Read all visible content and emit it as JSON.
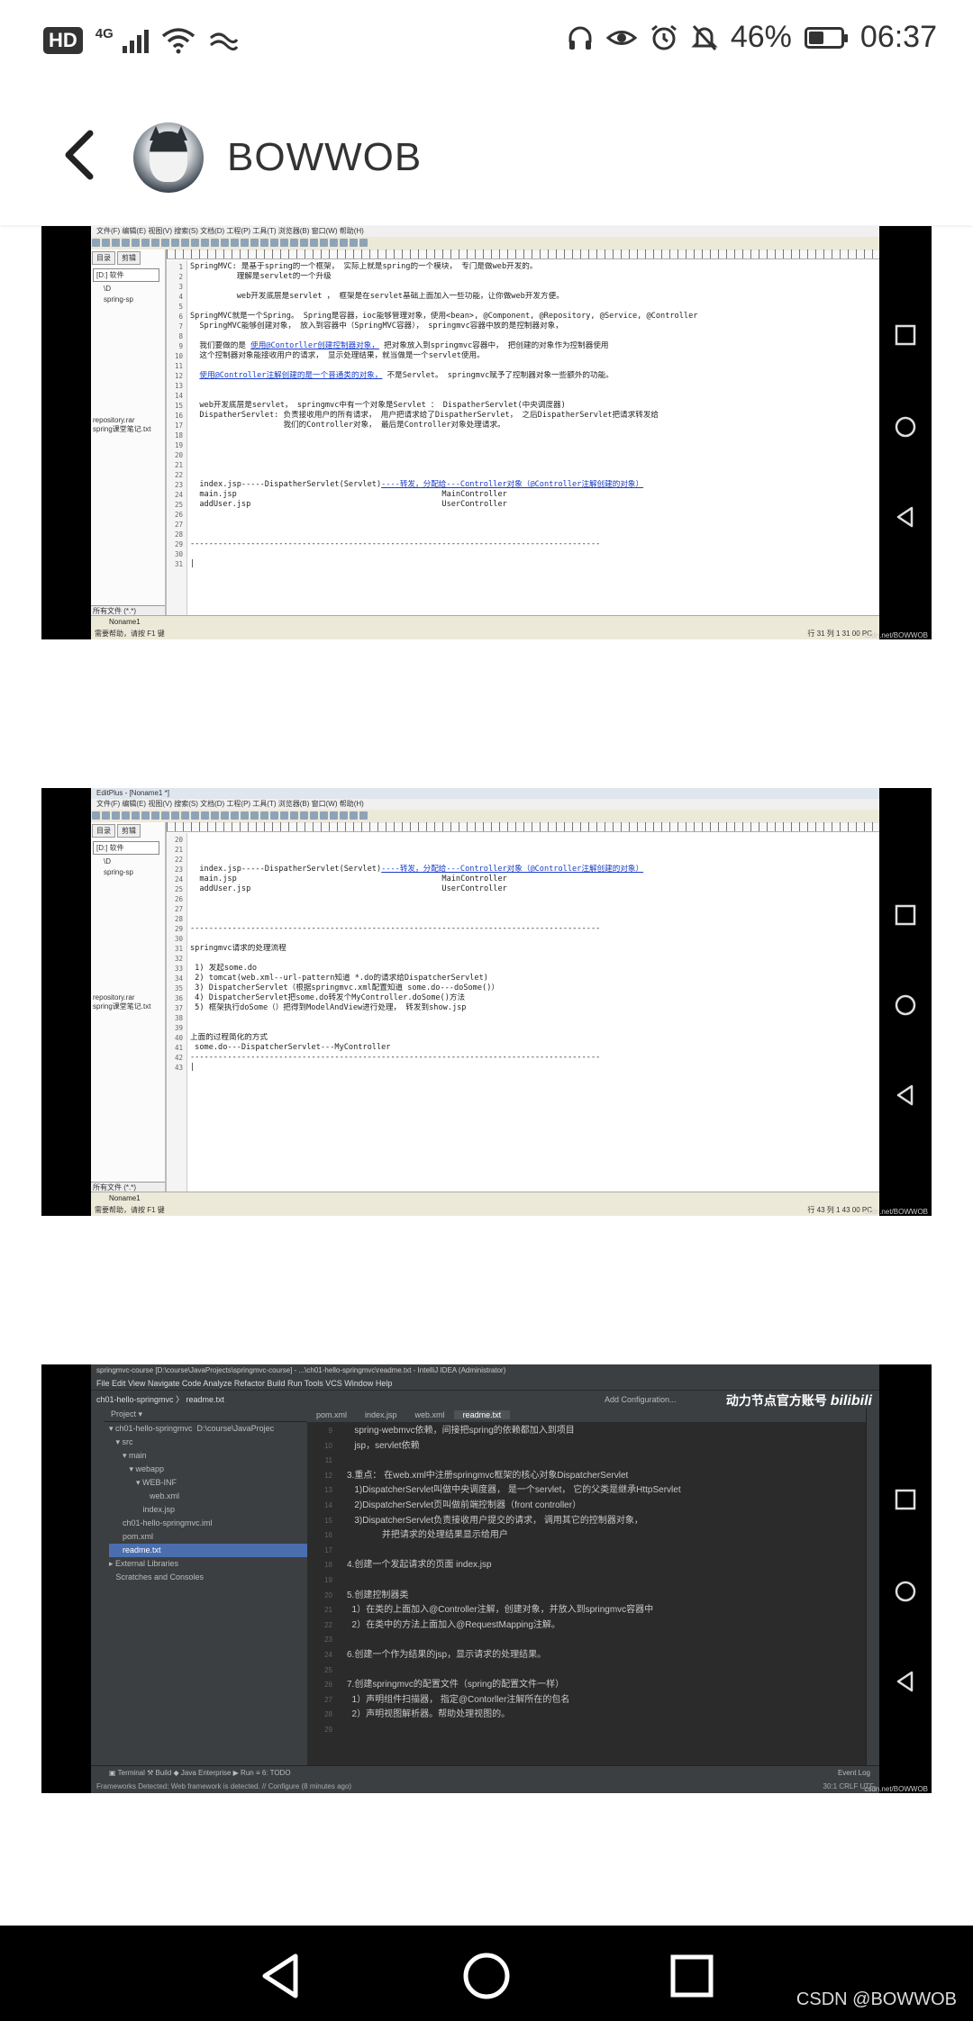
{
  "status_bar": {
    "hd": "HD",
    "network": "4G",
    "battery_percent": "46%",
    "battery_level": 0.46,
    "time": "06:37",
    "icons": [
      "signal-icon",
      "wifi-icon",
      "weather-icon",
      "headphones-icon",
      "eye-icon",
      "alarm-icon",
      "mute-icon",
      "battery-icon"
    ]
  },
  "header": {
    "username": "BOWWOB"
  },
  "frame1": {
    "menu": "文件(F)  编辑(E)  视图(V)  搜索(S)  文档(D)  工程(P)  工具(T)  浏览器(B)  窗口(W)  帮助(H)",
    "pane_tabs": [
      "目录",
      "剪辑"
    ],
    "drive": "[D:] 软件",
    "tree": [
      "\\D",
      "spring-sp"
    ],
    "files": [
      "repository.rar",
      "spring课堂笔记.txt"
    ],
    "filter": "所有文件 (*.*)",
    "doc_tab": "Noname1",
    "status_left": "需要帮助，请按 F1 键",
    "status_right": "行 31    列 1    31    00    PC",
    "lines": [
      {
        "n": "1",
        "t": "SpringMVC: 是基于spring的一个框架， 实际上就是spring的一个模块， 专门是做web开发的。"
      },
      {
        "n": "2",
        "t": "          理解是servlet的一个升级"
      },
      {
        "n": "3",
        "t": ""
      },
      {
        "n": "4",
        "t": "          web开发底层是servlet ， 框架是在servlet基础上面加入一些功能，让你做web开发方便。"
      },
      {
        "n": "5",
        "t": ""
      },
      {
        "n": "6",
        "t": "SpringMVC就是一个Spring。 Spring是容器，ioc能够管理对象，使用<bean>, @Component, @Repository, @Service, @Controller"
      },
      {
        "n": "7",
        "t": "  SpringMVC能够创建对象， 放入到容器中（SpringMVC容器）， springmvc容器中放的是控制器对象，"
      },
      {
        "n": "8",
        "t": ""
      },
      {
        "n": "9",
        "t": "  我们要做的是 使用@Contorller创建控制器对象， 把对象放入到springmvc容器中， 把创建的对象作为控制器使用"
      },
      {
        "n": "10",
        "t": "  这个控制器对象能接收用户的请求， 显示处理结果，就当做是一个servlet使用。"
      },
      {
        "n": "11",
        "t": ""
      },
      {
        "n": "12",
        "t": "  使用@Controller注解创建的是一个普通类的对象， 不是Servlet。 springmvc赋予了控制器对象一些额外的功能。"
      },
      {
        "n": "13",
        "t": ""
      },
      {
        "n": "14",
        "t": ""
      },
      {
        "n": "15",
        "t": "  web开发底层是servlet， springmvc中有一个对象是Servlet ： DispatherServlet(中央调度器)"
      },
      {
        "n": "16",
        "t": "  DispatherServlet: 负责接收用户的所有请求， 用户把请求给了DispatherServlet， 之后DispatherServlet把请求转发给"
      },
      {
        "n": "17",
        "t": "                    我们的Controller对象， 最后是Controller对象处理请求。"
      },
      {
        "n": "18",
        "t": ""
      },
      {
        "n": "19",
        "t": ""
      },
      {
        "n": "20",
        "t": ""
      },
      {
        "n": "21",
        "t": ""
      },
      {
        "n": "22",
        "t": ""
      },
      {
        "n": "23",
        "t": "  index.jsp-----DispatherServlet(Servlet)----转发，分配给---Controller对象（@Controller注解创建的对象）"
      },
      {
        "n": "24",
        "t": "  main.jsp                                            MainController"
      },
      {
        "n": "25",
        "t": "  addUser.jsp                                         UserController"
      },
      {
        "n": "26",
        "t": ""
      },
      {
        "n": "27",
        "t": ""
      },
      {
        "n": "28",
        "t": ""
      },
      {
        "n": "29",
        "t": "----------------------------------------------------------------------------------------"
      },
      {
        "n": "30",
        "t": ""
      },
      {
        "n": "31",
        "t": "|"
      }
    ]
  },
  "frame2": {
    "title": "EditPlus - [Noname1 *]",
    "menu": "文件(F)  编辑(E)  视图(V)  搜索(S)  文档(D)  工程(P)  工具(T)  浏览器(B)  窗口(W)  帮助(H)",
    "pane_tabs": [
      "目录",
      "剪辑"
    ],
    "drive": "[D:] 软件",
    "tree": [
      "\\D",
      "spring-sp"
    ],
    "files": [
      "repository.rar",
      "spring课堂笔记.txt"
    ],
    "filter": "所有文件 (*.*)",
    "doc_tab": "Noname1",
    "status_left": "需要帮助，请按 F1 键",
    "status_right": "行 43    列 1    43    00    PC",
    "lines": [
      {
        "n": "20",
        "t": ""
      },
      {
        "n": "21",
        "t": ""
      },
      {
        "n": "22",
        "t": ""
      },
      {
        "n": "23",
        "t": "  index.jsp-----DispatherServlet(Servlet)----转发，分配给---Controller对象（@Controller注解创建的对象）"
      },
      {
        "n": "24",
        "t": "  main.jsp                                            MainController"
      },
      {
        "n": "25",
        "t": "  addUser.jsp                                         UserController"
      },
      {
        "n": "26",
        "t": ""
      },
      {
        "n": "27",
        "t": ""
      },
      {
        "n": "28",
        "t": ""
      },
      {
        "n": "29",
        "t": "----------------------------------------------------------------------------------------"
      },
      {
        "n": "30",
        "t": ""
      },
      {
        "n": "31",
        "t": "springmvc请求的处理流程"
      },
      {
        "n": "32",
        "t": ""
      },
      {
        "n": "33",
        "t": " 1) 发起some.do"
      },
      {
        "n": "34",
        "t": " 2) tomcat(web.xml--url-pattern知道 *.do的请求给DispatcherServlet)"
      },
      {
        "n": "35",
        "t": " 3) DispatcherServlet（根据springmvc.xml配置知道 some.do---doSome()）"
      },
      {
        "n": "36",
        "t": " 4) DispatcherServlet把some.do转发个MyController.doSome()方法"
      },
      {
        "n": "37",
        "t": " 5) 框架执行doSome（）把得到ModelAndView进行处理， 转发到show.jsp"
      },
      {
        "n": "38",
        "t": ""
      },
      {
        "n": "39",
        "t": ""
      },
      {
        "n": "40",
        "t": "上面的过程简化的方式"
      },
      {
        "n": "41",
        "t": " some.do---DispatcherServlet---MyController"
      },
      {
        "n": "42",
        "t": "----------------------------------------------------------------------------------------"
      },
      {
        "n": "43",
        "t": "|"
      }
    ]
  },
  "frame3": {
    "title": "springmvc-course [D:\\course\\JavaProjects\\springmvc-course] - ...\\ch01-hello-springmvc\\readme.txt - IntelliJ IDEA (Administrator)",
    "menu": "File  Edit  View  Navigate  Code  Analyze  Refactor  Build  Run  Tools  VCS  Window  Help",
    "nav": "ch01-hello-springmvc  〉 readme.txt",
    "add_config": "Add Configuration...",
    "brand": "动力节点官方账号",
    "brand_logo": "bilibili",
    "project_label": "Project ▾",
    "tabs": [
      "pom.xml",
      "index.jsp",
      "web.xml",
      "readme.txt"
    ],
    "tree": [
      "▾ ch01-hello-springmvc  D:\\course\\JavaProjec",
      "   ▾ src",
      "      ▾ main",
      "         ▾ webapp",
      "            ▾ WEB-INF",
      "                  web.xml",
      "               index.jsp",
      "      ch01-hello-springmvc.iml",
      "      pom.xml",
      "      readme.txt",
      "▸ External Libraries",
      "   Scratches and Consoles"
    ],
    "lines": [
      {
        "n": "9",
        "t": "   spring-webmvc依赖，间接把spring的依赖都加入到项目"
      },
      {
        "n": "10",
        "t": "   jsp，servlet依赖"
      },
      {
        "n": "11",
        "t": ""
      },
      {
        "n": "12",
        "t": "3.重点： 在web.xml中注册springmvc框架的核心对象DispatcherServlet"
      },
      {
        "n": "13",
        "t": "   1)DispatcherServlet叫做中央调度器， 是一个servlet， 它的父类是继承HttpServlet"
      },
      {
        "n": "14",
        "t": "   2)DispatcherServlet页叫做前端控制器（front controller）"
      },
      {
        "n": "15",
        "t": "   3)DispatcherServlet负责接收用户提交的请求， 调用其它的控制器对象，"
      },
      {
        "n": "16",
        "t": "              并把请求的处理结果显示给用户"
      },
      {
        "n": "17",
        "t": ""
      },
      {
        "n": "18",
        "t": "4.创建一个发起请求的页面 index.jsp"
      },
      {
        "n": "19",
        "t": ""
      },
      {
        "n": "20",
        "t": "5.创建控制器类"
      },
      {
        "n": "21",
        "t": "  1）在类的上面加入@Controller注解，创建对象，并放入到springmvc容器中"
      },
      {
        "n": "22",
        "t": "  2）在类中的方法上面加入@RequestMapping注解。"
      },
      {
        "n": "23",
        "t": ""
      },
      {
        "n": "24",
        "t": "6.创建一个作为结果的jsp，显示请求的处理结果。"
      },
      {
        "n": "25",
        "t": ""
      },
      {
        "n": "26",
        "t": "7.创建springmvc的配置文件（spring的配置文件一样）"
      },
      {
        "n": "27",
        "t": "  1）声明组件扫描器， 指定@Contorller注解所在的包名"
      },
      {
        "n": "28",
        "t": "  2）声明视图解析器。帮助处理视图的。"
      },
      {
        "n": "29",
        "t": ""
      }
    ],
    "bottom_tools": "▣ Terminal   ⚒ Build   ◆ Java Enterprise   ▶ Run   ≡ 6: TODO",
    "event_log": "Event Log",
    "status": "Frameworks Detected: Web framework is detected. // Configure (8 minutes ago)",
    "status_right": "30:1   CRLF   UTF"
  },
  "watermark": "csdn.net/BOWWOB",
  "nav": {
    "csdn_label": "CSDN @BOWWOB"
  }
}
